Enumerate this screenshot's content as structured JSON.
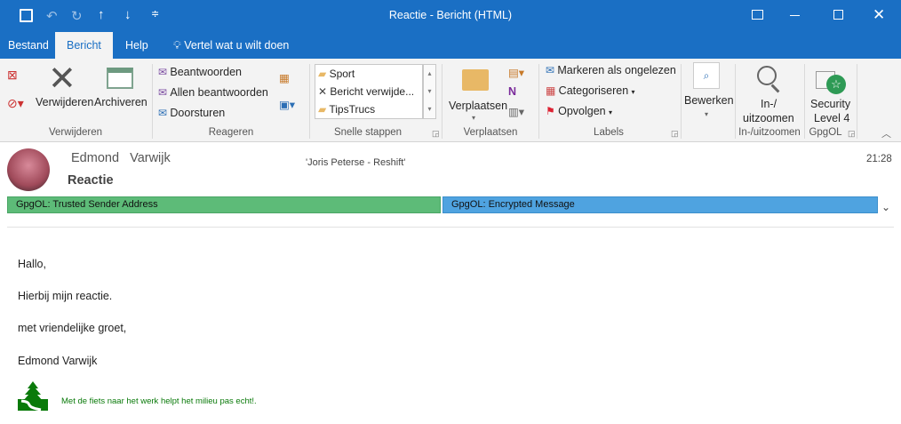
{
  "window": {
    "title": "Reactie  -  Bericht (HTML)"
  },
  "tabs": [
    {
      "label": "Bestand"
    },
    {
      "label": "Bericht"
    },
    {
      "label": "Help"
    },
    {
      "label": "Vertel wat u wilt doen"
    }
  ],
  "ribbon": {
    "delete_group": {
      "label": "Verwijderen",
      "delete": "Verwijderen",
      "archive": "Archiveren"
    },
    "respond_group": {
      "label": "Reageren",
      "reply": "Beantwoorden",
      "reply_all": "Allen beantwoorden",
      "forward": "Doorsturen"
    },
    "quick_steps": {
      "label": "Snelle stappen",
      "items": [
        "Sport",
        "Bericht verwijde...",
        "TipsTrucs"
      ]
    },
    "move_group": {
      "label": "Verplaatsen",
      "move": "Verplaatsen"
    },
    "tags_group": {
      "label": "Labels",
      "unread": "Markeren als ongelezen",
      "categorize": "Categoriseren",
      "follow_up": "Opvolgen"
    },
    "edit_group": {
      "label": "Bewerken"
    },
    "zoom_group": {
      "label": "In-/uitzoomen",
      "zoom1": "In-/",
      "zoom2": "uitzoomen"
    },
    "gpgol_group": {
      "label": "GpgOL",
      "sec1": "Security",
      "sec2": "Level 4"
    }
  },
  "message": {
    "sender": "Edmond   Varwijk",
    "to": "'Joris Peterse - Reshift'",
    "time": "21:28",
    "subject": "Reactie",
    "bar_trusted": "GpgOL: Trusted Sender Address",
    "bar_encrypted": "GpgOL: Encrypted Message",
    "colors": {
      "trusted": "#5dbb78",
      "encrypted": "#4fa3e0"
    },
    "body": [
      "Hallo,",
      "Hierbij mijn reactie.",
      "met vriendelijke groet,",
      "Edmond Varwijk"
    ],
    "signature": "Met de fiets naar het werk helpt het milieu pas echt!."
  }
}
